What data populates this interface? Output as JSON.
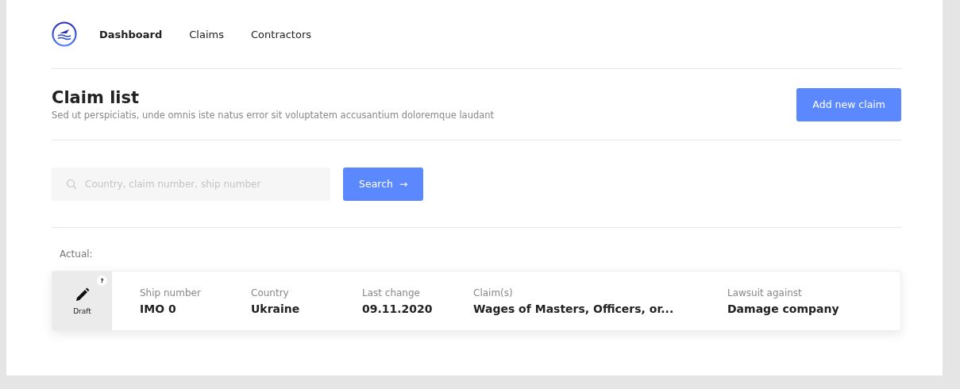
{
  "nav": {
    "items": [
      {
        "label": "Dashboard",
        "selected": true
      },
      {
        "label": "Claims",
        "selected": false
      },
      {
        "label": "Contractors",
        "selected": false
      }
    ]
  },
  "header": {
    "title": "Claim list",
    "subtitle": "Sed ut perspiciatis, unde omnis iste natus error sit voluptatem accusantium doloremque laudant",
    "button": "Add new claim"
  },
  "search": {
    "placeholder": "Country, claim number, ship number",
    "button": "Search",
    "button_icon": "→"
  },
  "section_label": "Actual:",
  "claims": [
    {
      "status": "Draft",
      "help": "?",
      "fields": [
        {
          "label": "Ship number",
          "value": "IMO 0"
        },
        {
          "label": "Country",
          "value": "Ukraine"
        },
        {
          "label": "Last change",
          "value": "09.11.2020"
        },
        {
          "label": "Claim(s)",
          "value": "Wages of Masters, Officers, or..."
        },
        {
          "label": "Lawsuit against",
          "value": "Damage company"
        }
      ]
    }
  ]
}
